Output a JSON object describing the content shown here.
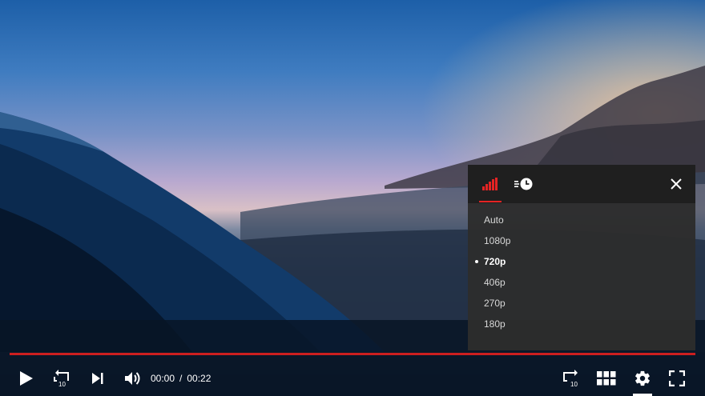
{
  "player": {
    "time": {
      "current": "00:00",
      "separator": "/",
      "duration": "00:22"
    },
    "progress_fraction": 0.0,
    "accent_color": "#e52424"
  },
  "settings_panel": {
    "tabs": [
      {
        "icon": "signal-bars-icon",
        "active": true
      },
      {
        "icon": "playback-speed-icon",
        "active": false
      }
    ],
    "quality_options": [
      "Auto",
      "1080p",
      "720p",
      "406p",
      "270p",
      "180p"
    ],
    "selected_quality": "720p"
  },
  "controls": {
    "left": [
      "play-icon",
      "replay-10-icon",
      "next-icon",
      "volume-icon"
    ],
    "right": [
      "forward-10-icon",
      "grid-icon",
      "gear-icon",
      "fullscreen-icon"
    ],
    "replay_seconds": "10",
    "forward_seconds": "10"
  }
}
